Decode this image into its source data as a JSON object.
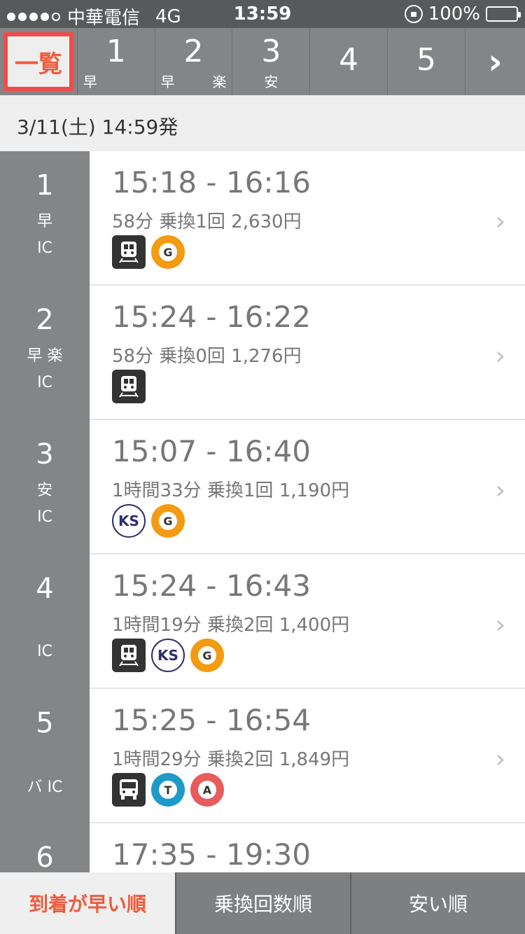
{
  "status_bar": {
    "carrier": "中華電信",
    "network": "4G",
    "time": "13:59",
    "battery": "100%",
    "signal_dots_filled": 4,
    "signal_dots_total": 5
  },
  "tabs": {
    "all_label": "一覧",
    "items": [
      {
        "num": "1",
        "marks": [
          "早"
        ]
      },
      {
        "num": "2",
        "marks": [
          "早",
          "楽"
        ]
      },
      {
        "num": "3",
        "marks": [
          "安"
        ]
      },
      {
        "num": "4",
        "marks": []
      },
      {
        "num": "5",
        "marks": []
      }
    ],
    "next_icon": "chevron-right-icon"
  },
  "date": "3/11(土) 14:59発",
  "routes": [
    {
      "num": "1",
      "marks": "早",
      "ic": "IC",
      "times": "15:18 - 16:16",
      "detail": "58分 乗換1回 2,630円",
      "icons": [
        "train",
        "G"
      ]
    },
    {
      "num": "2",
      "marks": "早 楽",
      "ic": "IC",
      "times": "15:24 - 16:22",
      "detail": "58分 乗換0回 1,276円",
      "icons": [
        "train"
      ]
    },
    {
      "num": "3",
      "marks": "安",
      "ic": "IC",
      "times": "15:07 - 16:40",
      "detail": "1時間33分 乗換1回 1,190円",
      "icons": [
        "KS",
        "G"
      ]
    },
    {
      "num": "4",
      "marks": "",
      "ic": "IC",
      "times": "15:24 - 16:43",
      "detail": "1時間19分 乗換2回 1,400円",
      "icons": [
        "train",
        "KS",
        "G"
      ]
    },
    {
      "num": "5",
      "marks": "バ IC",
      "ic": "",
      "times": "15:25 - 16:54",
      "detail": "1時間29分 乗換2回 1,849円",
      "icons": [
        "bus",
        "T",
        "A"
      ]
    },
    {
      "num": "6",
      "marks": "",
      "ic": "",
      "times": "17:35 - 19:30",
      "detail": "",
      "icons": []
    }
  ],
  "sort": {
    "arrival": "到着が早い順",
    "transfers": "乗換回数順",
    "cheap": "安い順"
  },
  "colors": {
    "accent": "#ef5a3c",
    "highlight_border": "#f04b4b",
    "tab_bg": "#848586",
    "status_bg": "#58595b"
  }
}
